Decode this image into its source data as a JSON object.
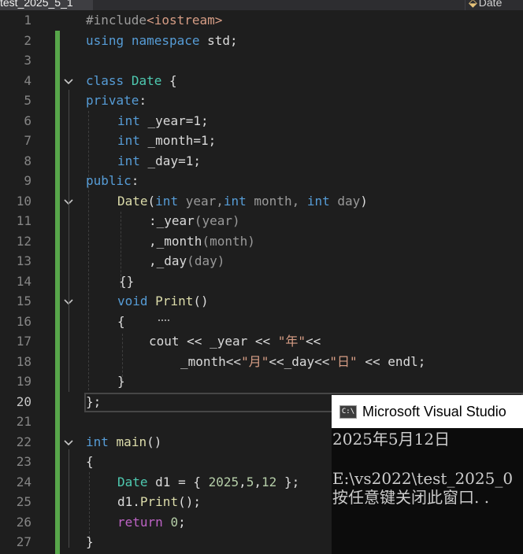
{
  "tabs": {
    "active_file": "test_2025_5_1",
    "file_2": "Date"
  },
  "editor": {
    "active_line": 20,
    "line_numbers": [
      "1",
      "2",
      "3",
      "4",
      "5",
      "6",
      "7",
      "8",
      "9",
      "10",
      "11",
      "12",
      "13",
      "14",
      "15",
      "16",
      "17",
      "18",
      "19",
      "20",
      "21",
      "22",
      "23",
      "24",
      "25",
      "26",
      "27"
    ],
    "code": {
      "l1": {
        "pre": "#include",
        "hdr": "<iostream>"
      },
      "l2": {
        "kw1": "using",
        "kw2": "namespace",
        "id": "std;"
      },
      "l4": {
        "kw": "class",
        "type": "Date",
        "rest": " {"
      },
      "l5": {
        "kw": "private",
        "rest": ":"
      },
      "l6": {
        "kw": "int",
        "rest": " _year=1;"
      },
      "l7": {
        "kw": "int",
        "rest": " _month=1;"
      },
      "l8": {
        "kw": "int",
        "rest": " _day=1;"
      },
      "l9": {
        "kw": "public",
        "rest": ":"
      },
      "l10": {
        "fn": "Date",
        "p1": "(",
        "kw1": "int",
        "a1": " year,",
        "kw2": "int",
        "a2": " month, ",
        "kw3": "int",
        "a3": " day",
        "p2": ")"
      },
      "l11": {
        "a": ":_year",
        "b": "(",
        "c": "year",
        "d": ")"
      },
      "l12": {
        "a": ",_month",
        "b": "(",
        "c": "month",
        "d": ")"
      },
      "l13": {
        "a": ",_day",
        "b": "(",
        "c": "day",
        "d": ")"
      },
      "l14": {
        "text": "{}"
      },
      "l15": {
        "kw": "void",
        "fn": "Print",
        "rest": "()"
      },
      "l16": {
        "text": "{"
      },
      "l17": {
        "a": "cout << _year << ",
        "s": "\"年\"",
        "b": "<<"
      },
      "l18": {
        "a": "_month<<",
        "s1": "\"月\"",
        "b": "<<_day<<",
        "s2": "\"日\"",
        "c": " << endl;"
      },
      "l19": {
        "text": "}"
      },
      "l20": {
        "text": "};"
      },
      "l22": {
        "kw": "int",
        "fn": "main",
        "rest": "()"
      },
      "l23": {
        "text": "{"
      },
      "l24": {
        "type": "Date",
        "a": " d1 = { ",
        "n1": "2025",
        "b": ",",
        "n2": "5",
        "c": ",",
        "n3": "12",
        "d": " };"
      },
      "l25": {
        "a": "d1.",
        "fn": "Print",
        "b": "();"
      },
      "l26": {
        "kw": "return",
        "b": " ",
        "n": "0",
        "c": ";"
      },
      "l27": {
        "text": "}"
      }
    }
  },
  "console": {
    "icon_text": "C:\\",
    "title": "Microsoft Visual Studio",
    "output_line": "2025年5月12日",
    "path_line": "E:\\vs2022\\test_2025_0",
    "close_hint": "按任意键关闭此窗口. ."
  }
}
